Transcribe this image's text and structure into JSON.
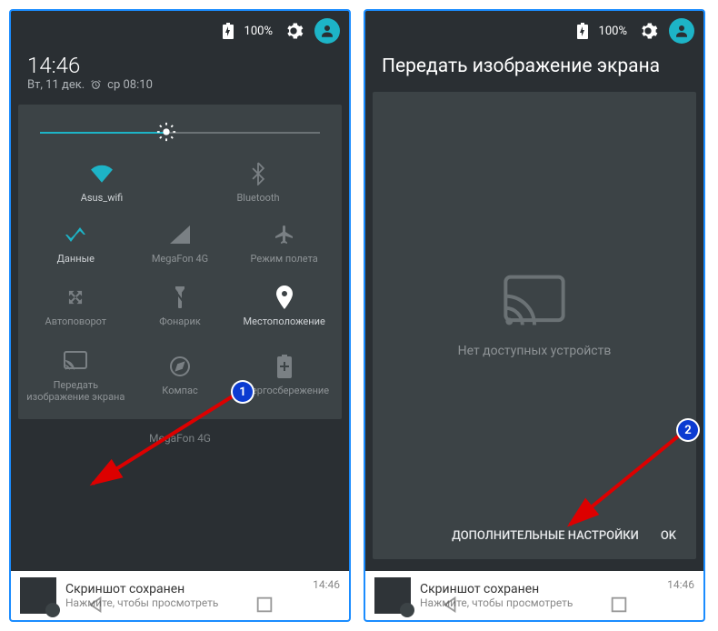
{
  "status": {
    "battery_pct": "100%"
  },
  "left": {
    "time": "14:46",
    "date": "Вт, 11 дек.",
    "alarm": "ср 08:10",
    "brightness_pct": 45,
    "tiles_row1": [
      {
        "label": "Asus_wifi",
        "icon": "wifi",
        "active": true
      },
      {
        "label": "Bluetooth",
        "icon": "bluetooth",
        "active": false
      }
    ],
    "tiles": [
      {
        "label": "Данные",
        "icon": "data",
        "active": true
      },
      {
        "label": "MegaFon 4G",
        "icon": "signal",
        "active": false
      },
      {
        "label": "Режим полета",
        "icon": "airplane",
        "active": false
      },
      {
        "label": "Автоповорот",
        "icon": "rotate",
        "active": false
      },
      {
        "label": "Фонарик",
        "icon": "flashlight",
        "active": false
      },
      {
        "label": "Местоположение",
        "icon": "location",
        "active": true
      },
      {
        "label": "Передать изображение экрана",
        "icon": "cast",
        "active": false
      },
      {
        "label": "Компас",
        "icon": "compass",
        "active": false
      },
      {
        "label": "Энергосбережение",
        "icon": "battery-saver",
        "active": false
      }
    ],
    "carrier": "MegaFon 4G"
  },
  "right": {
    "title": "Передать изображение экрана",
    "empty_msg": "Нет доступных устройств",
    "action_more": "ДОПОЛНИТЕЛЬНЫЕ НАСТРОЙКИ",
    "action_ok": "OK"
  },
  "notif": {
    "title": "Скриншот сохранен",
    "subtitle": "Нажмите, чтобы просмотреть",
    "time": "14:46"
  },
  "badges": {
    "b1": "1",
    "b2": "2"
  }
}
